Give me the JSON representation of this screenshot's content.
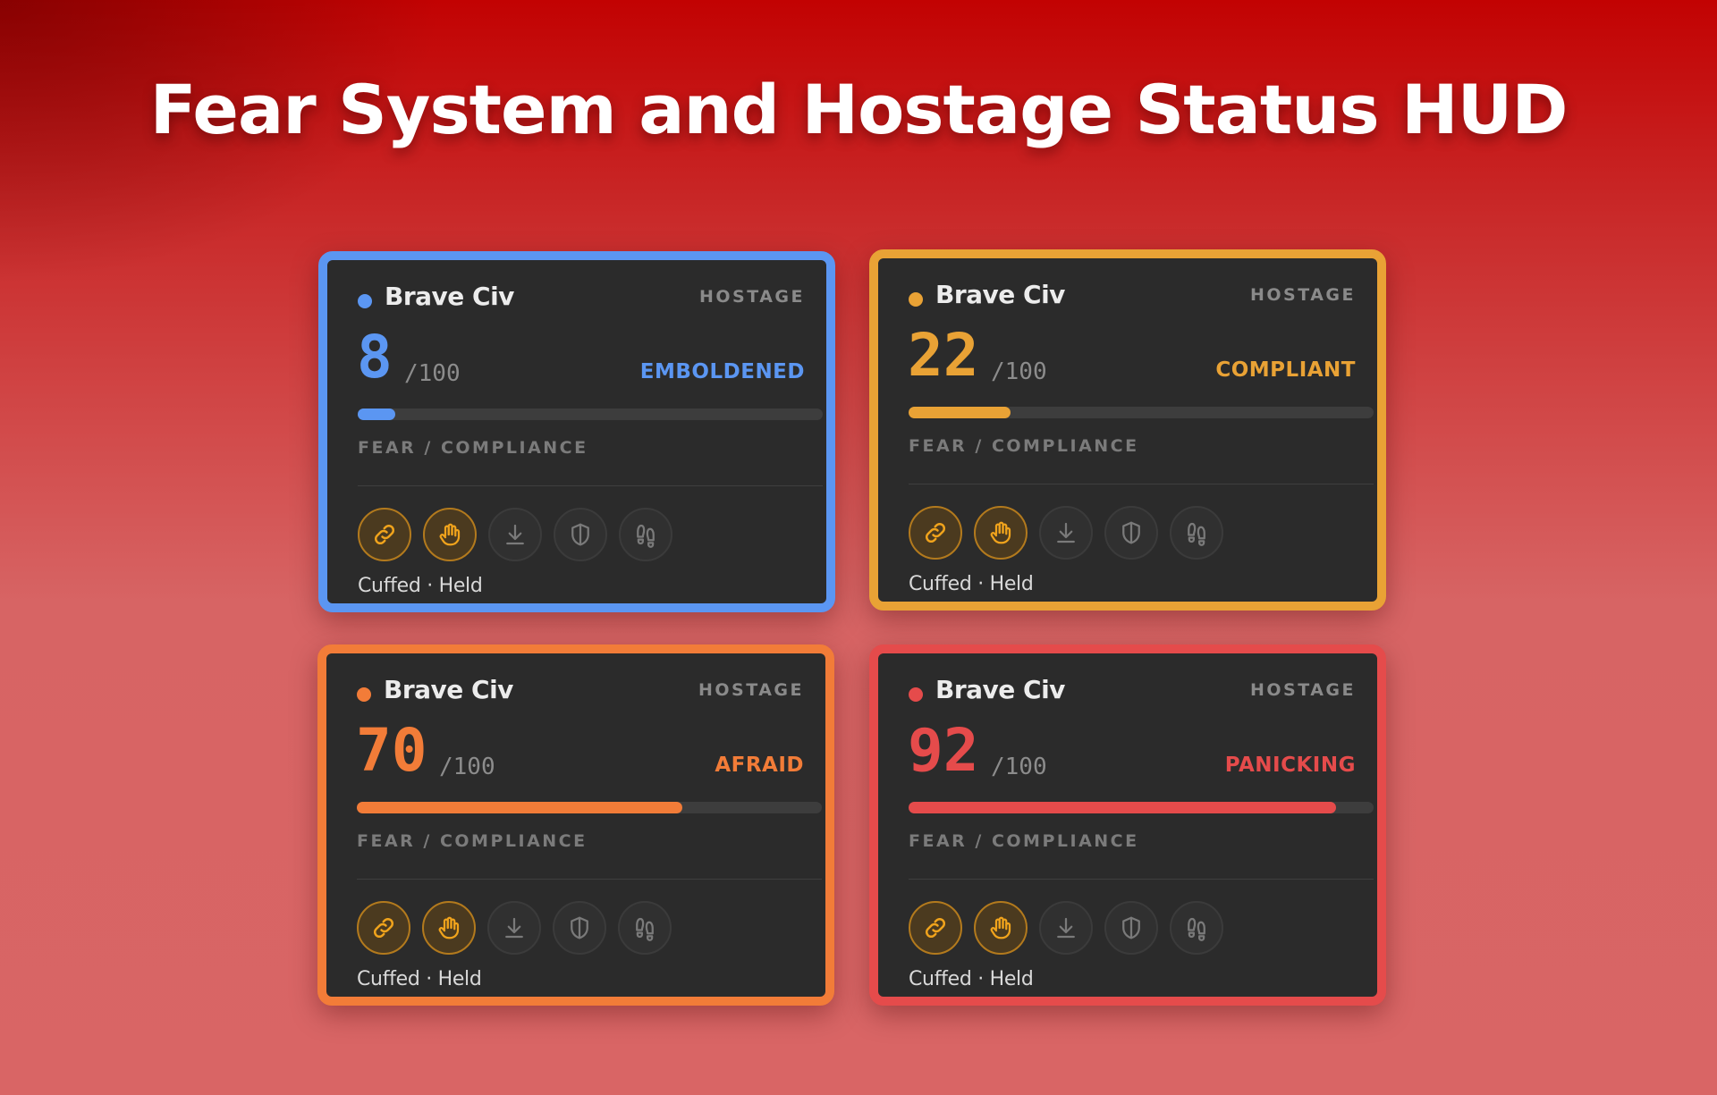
{
  "header": {
    "title": "Fear System and Hostage Status HUD"
  },
  "cards": [
    {
      "name": "Brave Civ",
      "tag": "HOSTAGE",
      "score": "8",
      "max": "/100",
      "state": "EMBOLDENED",
      "label": "FEAR / COMPLIANCE",
      "status": "Cuffed · Held",
      "fear_level": 8,
      "accent": "#5b96f2"
    },
    {
      "name": "Brave Civ",
      "tag": "HOSTAGE",
      "score": "22",
      "max": "/100",
      "state": "COMPLIANT",
      "label": "FEAR / COMPLIANCE",
      "status": "Cuffed · Held",
      "fear_level": 22,
      "accent": "#e9a235"
    },
    {
      "name": "Brave Civ",
      "tag": "HOSTAGE",
      "score": "70",
      "max": "/100",
      "state": "AFRAID",
      "label": "FEAR / COMPLIANCE",
      "status": "Cuffed · Held",
      "fear_level": 70,
      "accent": "#f27c38"
    },
    {
      "name": "Brave Civ",
      "tag": "HOSTAGE",
      "score": "92",
      "max": "/100",
      "state": "PANICKING",
      "label": "FEAR / COMPLIANCE",
      "status": "Cuffed · Held",
      "fear_level": 92,
      "accent": "#e54b4b"
    }
  ],
  "action_icons": [
    {
      "icon": "link-icon",
      "active": true
    },
    {
      "icon": "hand-icon",
      "active": true
    },
    {
      "icon": "download-icon",
      "active": false
    },
    {
      "icon": "shield-icon",
      "active": false
    },
    {
      "icon": "footprints-icon",
      "active": false
    }
  ]
}
